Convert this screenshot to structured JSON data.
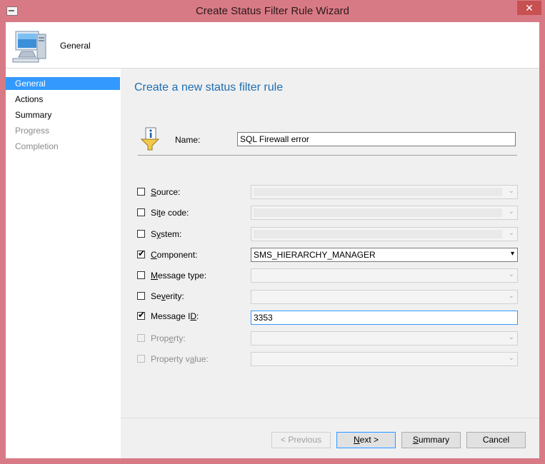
{
  "window": {
    "title": "Create Status Filter Rule Wizard",
    "close_glyph": "✕"
  },
  "header": {
    "label": "General",
    "icon": "computer-icon"
  },
  "nav": {
    "items": [
      {
        "label": "General",
        "state": "selected"
      },
      {
        "label": "Actions",
        "state": "normal"
      },
      {
        "label": "Summary",
        "state": "normal"
      },
      {
        "label": "Progress",
        "state": "disabled"
      },
      {
        "label": "Completion",
        "state": "disabled"
      }
    ]
  },
  "page": {
    "title": "Create a new status filter rule",
    "name_label": "Name:",
    "name_value": "SQL Firewall error"
  },
  "criteria": [
    {
      "label_pre": "",
      "label_ul": "S",
      "label_post": "ource:",
      "checked": false,
      "enabled": true,
      "value": ""
    },
    {
      "label_pre": "Si",
      "label_ul": "t",
      "label_post": "e code:",
      "checked": false,
      "enabled": true,
      "value": ""
    },
    {
      "label_pre": "S",
      "label_ul": "y",
      "label_post": "stem:",
      "checked": false,
      "enabled": true,
      "value": ""
    },
    {
      "label_pre": "",
      "label_ul": "C",
      "label_post": "omponent:",
      "checked": true,
      "enabled": true,
      "value": "SMS_HIERARCHY_MANAGER"
    },
    {
      "label_pre": "",
      "label_ul": "M",
      "label_post": "essage type:",
      "checked": false,
      "enabled": true,
      "value": ""
    },
    {
      "label_pre": "Se",
      "label_ul": "v",
      "label_post": "erity:",
      "checked": false,
      "enabled": true,
      "value": ""
    },
    {
      "label_pre": "Message I",
      "label_ul": "D",
      "label_post": ":",
      "checked": true,
      "enabled": true,
      "value": "3353"
    },
    {
      "label_pre": "Prop",
      "label_ul": "e",
      "label_post": "rty:",
      "checked": false,
      "enabled": false,
      "value": ""
    },
    {
      "label_pre": "Property v",
      "label_ul": "a",
      "label_post": "lue:",
      "checked": false,
      "enabled": false,
      "value": ""
    }
  ],
  "buttons": {
    "previous": "< Previous",
    "next_ul": "N",
    "next_rest": "ext >",
    "summary_ul": "S",
    "summary_rest": "ummary",
    "cancel": "Cancel"
  },
  "colors": {
    "accent": "#3399ff",
    "title_blue": "#1e6eb0",
    "frame": "#d87a85"
  }
}
